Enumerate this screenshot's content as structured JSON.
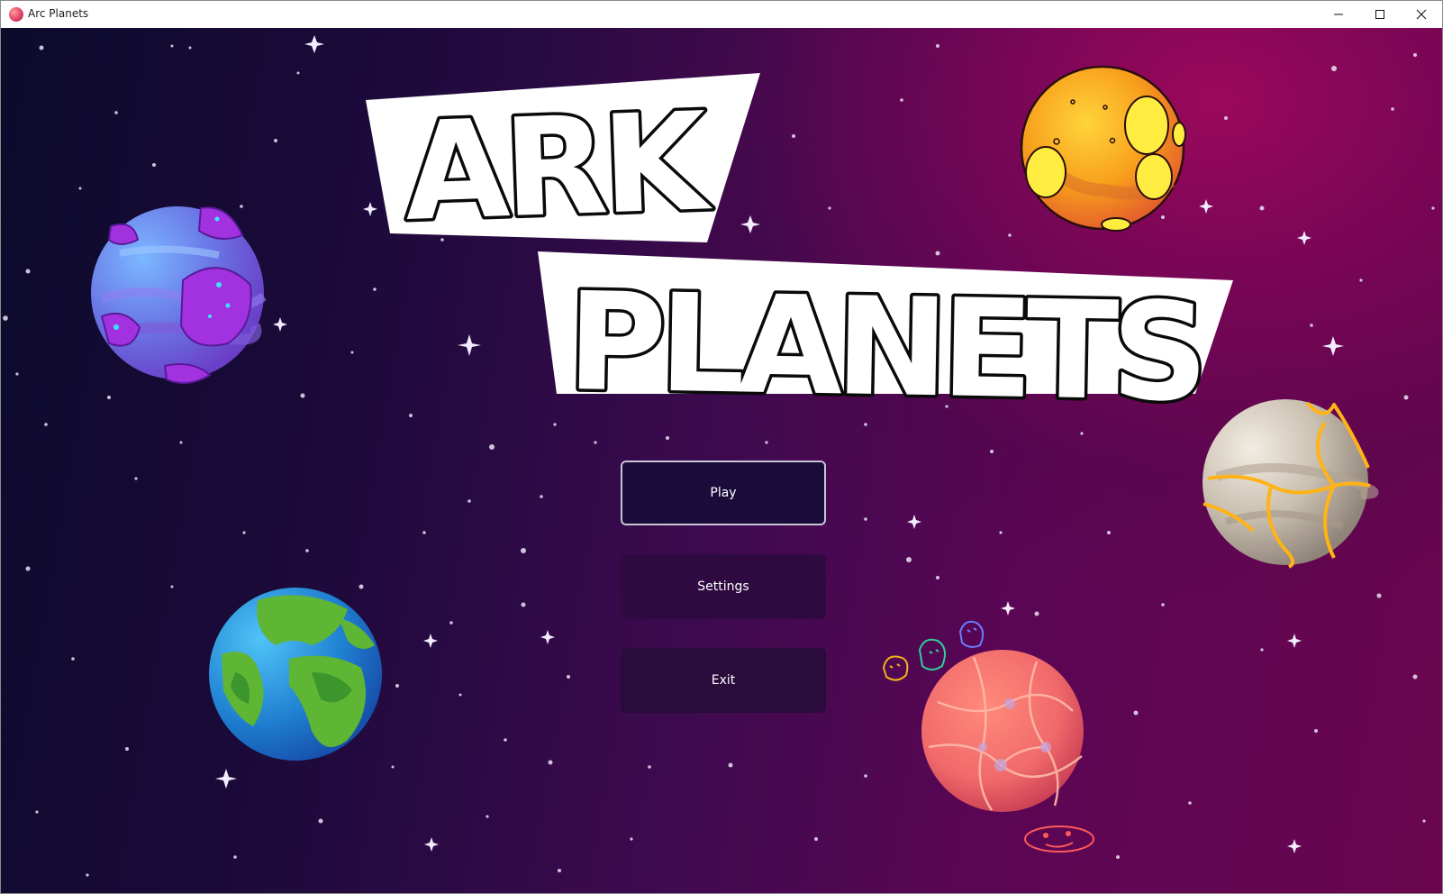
{
  "window": {
    "title": "Arc Planets",
    "icons": {
      "app": "planet-app-icon",
      "minimize": "minimize-icon",
      "maximize": "maximize-icon",
      "close": "close-icon"
    }
  },
  "logo": {
    "line1": "ARK",
    "line2": "PLANETS"
  },
  "menu": {
    "play_label": "Play",
    "settings_label": "Settings",
    "exit_label": "Exit"
  },
  "colors": {
    "background_dark": "#0c0b2c",
    "background_magenta": "#9e085c",
    "button_dark": "#1a0b3a",
    "button_border": "#c9c3d6"
  },
  "decor": [
    "purple-crystal-planet",
    "lava-crater-planet",
    "earth-planet",
    "molten-vein-planet",
    "pink-web-planet",
    "doodle-aliens"
  ]
}
